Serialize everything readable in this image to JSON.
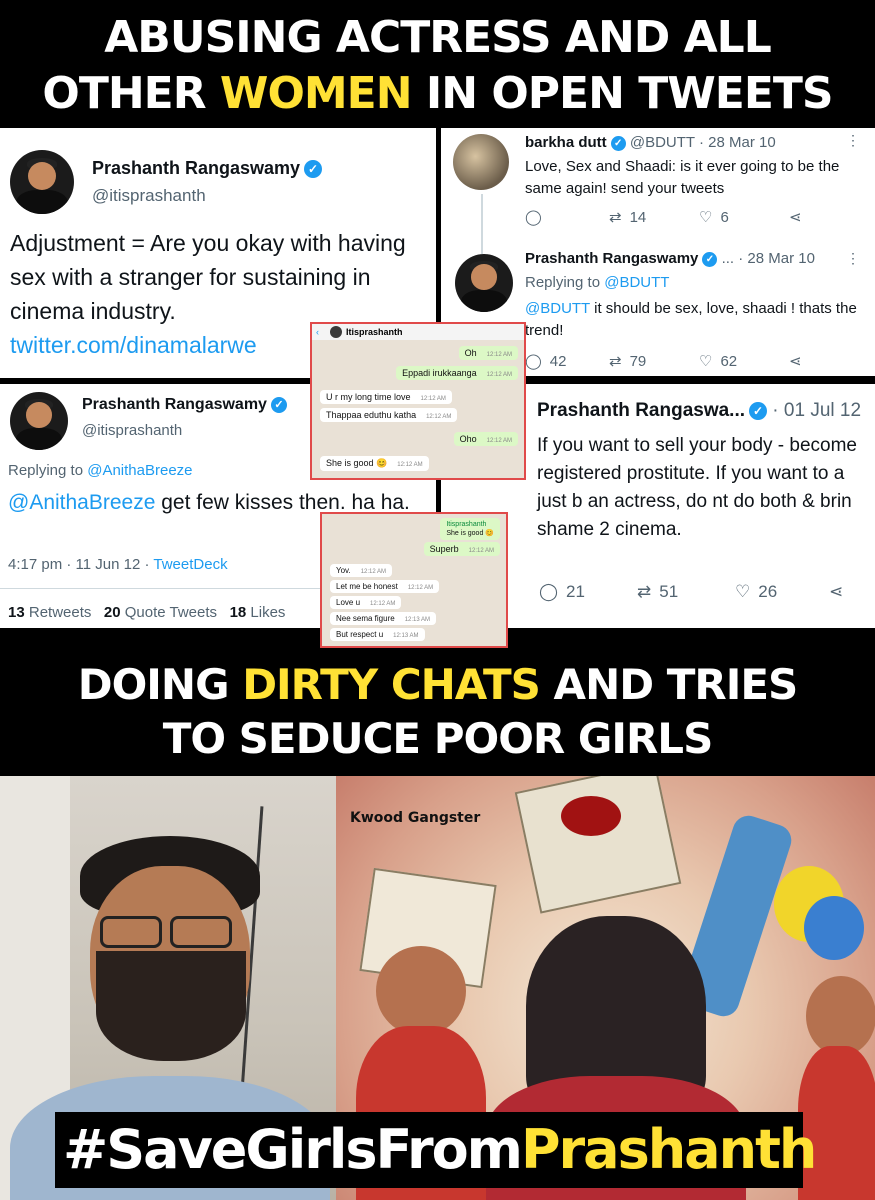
{
  "top_banner": {
    "line1": "ABUSING ACTRESS AND ALL",
    "line2_pre": "OTHER ",
    "line2_highlight": "WOMEN",
    "line2_post": " IN OPEN TWEETS"
  },
  "tweet1": {
    "name": "Prashanth Rangaswamy",
    "handle": "@itisprashanth",
    "text": "Adjustment = Are you okay with having sex with a stranger for sustaining in cinema industry.",
    "link": "twitter.com/dinamalarwe"
  },
  "tweet2": {
    "orig_name": "barkha dutt",
    "orig_meta": "@BDUTT · 28 Mar 10",
    "orig_text": "Love, Sex and Shaadi: is it ever going to be the same again! send your tweets",
    "orig_retweets": "14",
    "orig_likes": "6",
    "reply_name": "Prashanth Rangaswamy",
    "reply_meta": "... · 28 Mar 10",
    "reply_to_label": "Replying to ",
    "reply_to_handle": "@BDUTT",
    "reply_mention": "@BDUTT",
    "reply_text": " it should be sex, love, shaadi ! thats the trend!",
    "reply_comments": "42",
    "reply_retweets": "79",
    "reply_likes": "62"
  },
  "tweet3": {
    "name": "Prashanth Rangaswamy",
    "handle": "@itisprashanth",
    "reply_to_label": "Replying to ",
    "reply_to_handle": "@AnithaBreeze",
    "mention": "@AnithaBreeze",
    "text": " get few kisses then. ha ha.",
    "time": "4:17 pm · 11 Jun 12 · ",
    "source": "TweetDeck",
    "retweets": "13",
    "retweets_label": " Retweets",
    "quotes": "20",
    "quotes_label": " Quote Tweets",
    "likes": "18",
    "likes_label": " Likes"
  },
  "tweet4": {
    "name": "Prashanth Rangaswa...",
    "meta": "· 01 Jul 12",
    "text": "If you want to sell your body - become registered prostitute. If you want to a just b an actress, do nt do both & brin shame 2 cinema.",
    "comments": "21",
    "retweets": "51",
    "likes": "26"
  },
  "chat1": {
    "contact": "Itisprashanth",
    "messages": [
      {
        "text": "Oh",
        "time": "12:12 AM",
        "side": "out"
      },
      {
        "text": "Eppadi irukkaanga",
        "time": "12:12 AM",
        "side": "out"
      },
      {
        "text": "U r my long time love",
        "time": "12:12 AM",
        "side": "in"
      },
      {
        "text": "Thappaa eduthu katha",
        "time": "12:12 AM",
        "side": "in"
      },
      {
        "text": "Oho",
        "time": "12:12 AM",
        "side": "out"
      },
      {
        "text": "She is good 😊",
        "time": "12:12 AM",
        "side": "in"
      }
    ]
  },
  "chat2": {
    "quote_sender": "Itisprashanth",
    "quote_text": "She is good 😊",
    "messages": [
      {
        "text": "Superb",
        "time": "12:12 AM",
        "side": "out"
      },
      {
        "text": "Yov.",
        "time": "12:12 AM",
        "side": "in"
      },
      {
        "text": "Let me be honest",
        "time": "12:12 AM",
        "side": "in"
      },
      {
        "text": "Love u",
        "time": "12:12 AM",
        "side": "in"
      },
      {
        "text": "Nee sema figure",
        "time": "12:13 AM",
        "side": "in"
      },
      {
        "text": "But respect u",
        "time": "12:13 AM",
        "side": "in"
      }
    ]
  },
  "mid_banner": {
    "line1_pre": "DOING ",
    "line1_highlight": "DIRTY CHATS",
    "line1_post": " AND TRIES",
    "line2": "TO SEDUCE POOR GIRLS"
  },
  "illustration": {
    "caption": "Kwood Gangster"
  },
  "hashtag": {
    "prefix": "#SaveGirlsFrom",
    "highlight": "Prashanth"
  },
  "colors": {
    "highlight": "#ffe135",
    "twitter_blue": "#1d9bf0",
    "chat_border": "#e04a4a"
  }
}
